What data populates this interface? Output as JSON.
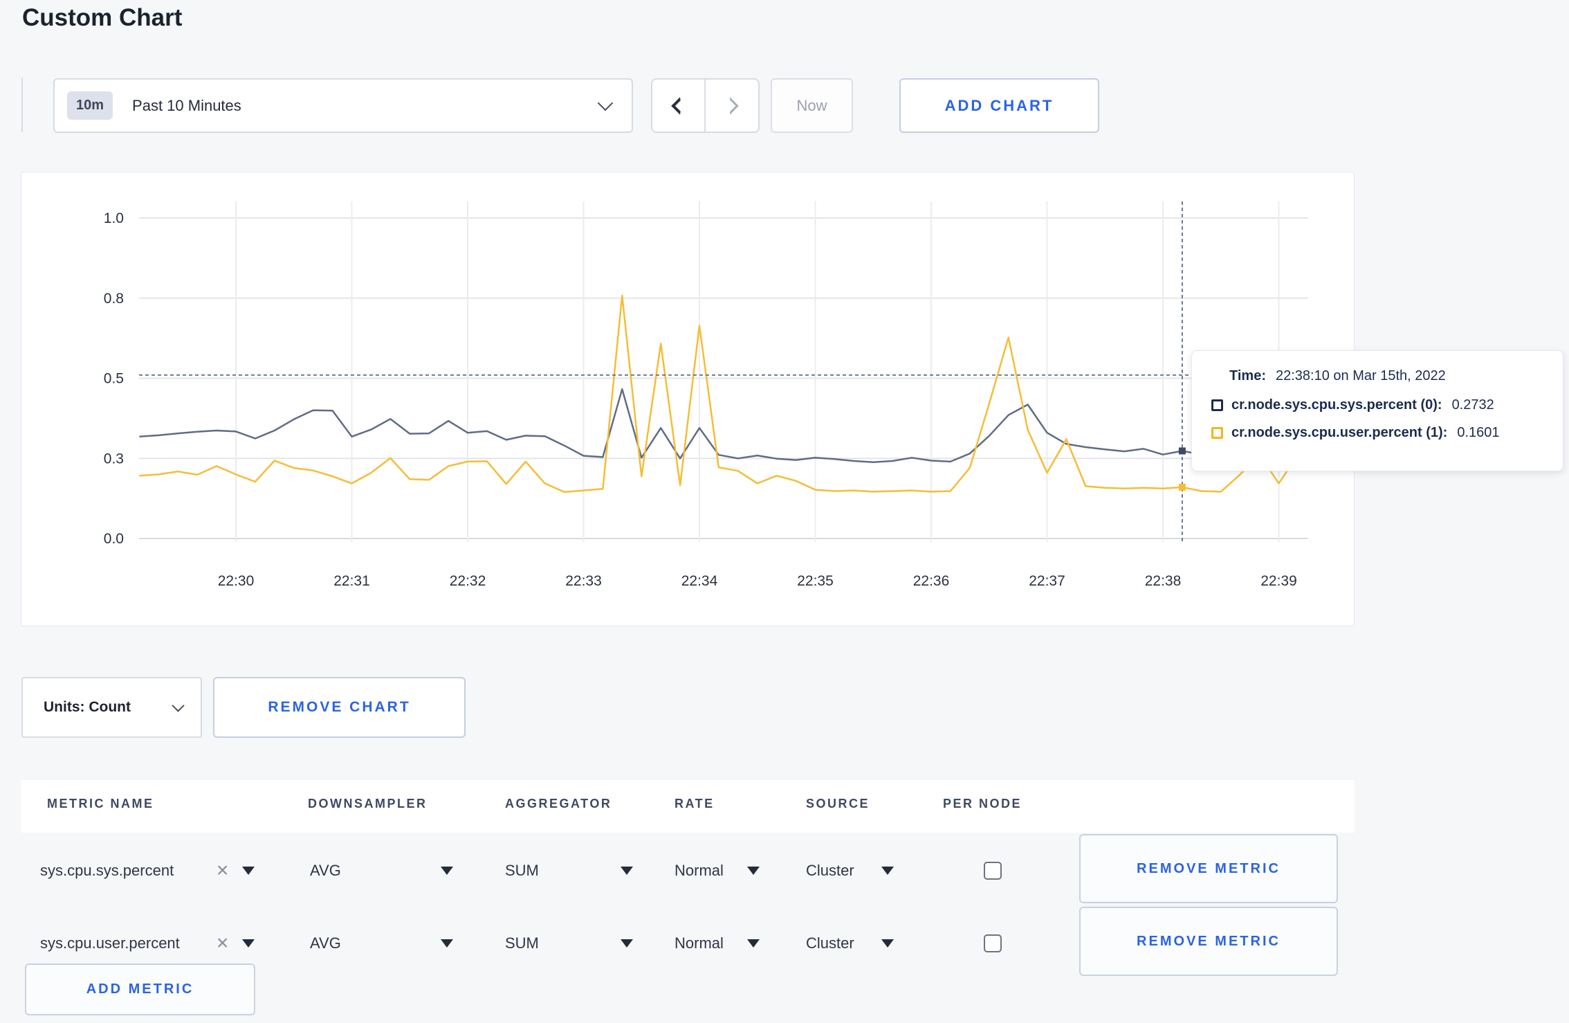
{
  "page": {
    "title": "Custom Chart"
  },
  "toolbar": {
    "time_range": {
      "badge": "10m",
      "label": "Past 10 Minutes"
    },
    "now_label": "Now",
    "add_chart_label": "ADD CHART"
  },
  "chart_data": {
    "type": "line",
    "title": "",
    "xlabel": "",
    "ylabel": "",
    "ylim": [
      0,
      1
    ],
    "grid": true,
    "x_ticks": [
      "22:30",
      "22:31",
      "22:32",
      "22:33",
      "22:34",
      "22:35",
      "22:36",
      "22:37",
      "22:38",
      "22:39"
    ],
    "y_ticks": [
      {
        "v": 1.0,
        "label": "1.0"
      },
      {
        "v": 0.75,
        "label": "0.8"
      },
      {
        "v": 0.5,
        "label": "0.5"
      },
      {
        "v": 0.25,
        "label": "0.3"
      },
      {
        "v": 0.0,
        "label": "0.0"
      }
    ],
    "start_time": "22:29:10",
    "interval_seconds": 10,
    "series": [
      {
        "name": "cr.node.sys.cpu.sys.percent",
        "color": "#5f6c87",
        "values": [
          0.318,
          0.322,
          0.328,
          0.333,
          0.337,
          0.334,
          0.312,
          0.337,
          0.372,
          0.4,
          0.399,
          0.318,
          0.34,
          0.373,
          0.327,
          0.328,
          0.367,
          0.33,
          0.335,
          0.308,
          0.321,
          0.319,
          0.29,
          0.258,
          0.254,
          0.466,
          0.252,
          0.345,
          0.25,
          0.345,
          0.261,
          0.25,
          0.259,
          0.249,
          0.245,
          0.252,
          0.248,
          0.242,
          0.238,
          0.242,
          0.252,
          0.243,
          0.24,
          0.265,
          0.32,
          0.385,
          0.418,
          0.33,
          0.295,
          0.285,
          0.278,
          0.272,
          0.28,
          0.262,
          0.2732,
          0.262,
          0.27,
          0.268,
          0.272,
          0.268,
          0.272
        ]
      },
      {
        "name": "cr.node.sys.cpu.user.percent",
        "color": "#f5bd36",
        "values": [
          0.196,
          0.2,
          0.209,
          0.199,
          0.226,
          0.2,
          0.177,
          0.243,
          0.22,
          0.212,
          0.194,
          0.172,
          0.205,
          0.251,
          0.185,
          0.183,
          0.226,
          0.24,
          0.241,
          0.17,
          0.24,
          0.172,
          0.145,
          0.15,
          0.155,
          0.758,
          0.194,
          0.608,
          0.166,
          0.664,
          0.222,
          0.211,
          0.172,
          0.196,
          0.18,
          0.152,
          0.148,
          0.15,
          0.146,
          0.148,
          0.15,
          0.146,
          0.148,
          0.22,
          0.42,
          0.627,
          0.34,
          0.205,
          0.31,
          0.163,
          0.158,
          0.156,
          0.158,
          0.156,
          0.1601,
          0.148,
          0.146,
          0.2,
          0.262,
          0.172,
          0.262
        ]
      }
    ],
    "legend_position": "tooltip",
    "crosshair": {
      "time": "22:38:10",
      "hover_value": 0.51
    }
  },
  "tooltip": {
    "time_label": "Time:",
    "time_value": "22:38:10 on Mar 15th, 2022",
    "entries": [
      {
        "label": "cr.node.sys.cpu.sys.percent (0):",
        "value": "0.2732",
        "color": "#1c2c4f"
      },
      {
        "label": "cr.node.sys.cpu.user.percent (1):",
        "value": "0.1601",
        "color": "#f0b61f"
      }
    ]
  },
  "chart_controls": {
    "units_label": "Units: Count",
    "remove_chart_label": "REMOVE CHART"
  },
  "metrics_table": {
    "headers": [
      "METRIC NAME",
      "DOWNSAMPLER",
      "AGGREGATOR",
      "RATE",
      "SOURCE",
      "PER NODE"
    ],
    "rows": [
      {
        "metric": "sys.cpu.sys.percent",
        "downsampler": "AVG",
        "aggregator": "SUM",
        "rate": "Normal",
        "source": "Cluster",
        "per_node": false,
        "remove_label": "REMOVE METRIC"
      },
      {
        "metric": "sys.cpu.user.percent",
        "downsampler": "AVG",
        "aggregator": "SUM",
        "rate": "Normal",
        "source": "Cluster",
        "per_node": false,
        "remove_label": "REMOVE METRIC"
      }
    ],
    "add_metric_label": "ADD METRIC"
  },
  "colors": {
    "accent_blue": "#2b63e4",
    "navy_text": "#1c2c4f",
    "grid_line": "#e7e8ec",
    "crosshair": "#5c6e84"
  }
}
